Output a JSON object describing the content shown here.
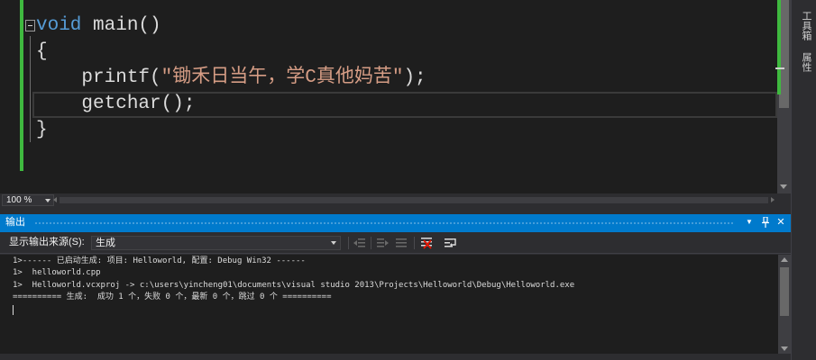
{
  "editor": {
    "lines": [
      {
        "keyword": "void",
        "rest": " main()"
      },
      {
        "text": "{"
      },
      {
        "prefix": "    printf(",
        "string": "\"锄禾日当午，学C真他妈苦\"",
        "suffix": ");"
      },
      {
        "text": "    getchar();"
      },
      {
        "text": "}"
      }
    ],
    "zoom": "100 %"
  },
  "side_tabs": [
    "工具箱",
    "属性"
  ],
  "output_panel": {
    "title": "输出",
    "source_label": "显示输出来源(S):",
    "source_value": "生成",
    "lines": [
      "1>------ 已启动生成: 项目: Helloworld, 配置: Debug Win32 ------",
      "1>  helloworld.cpp",
      "1>  Helloworld.vcxproj -> c:\\users\\yincheng01\\documents\\visual studio 2013\\Projects\\Helloworld\\Debug\\Helloworld.exe",
      "========== 生成:  成功 1 个，失败 0 个，最新 0 个，跳过 0 个 =========="
    ]
  },
  "icons": {
    "dropdown": "window-position-dropdown-icon",
    "pin": "pin-icon",
    "close": "close-icon",
    "toolbar": [
      "goto-previous-message-icon",
      "goto-next-message-icon",
      "find-message-icon",
      "clear-all-icon",
      "toggle-word-wrap-icon"
    ]
  },
  "colors": {
    "accent": "#007acc",
    "keyword": "#569cd6",
    "string": "#d69d85",
    "change_marker": "#3fb93f"
  }
}
